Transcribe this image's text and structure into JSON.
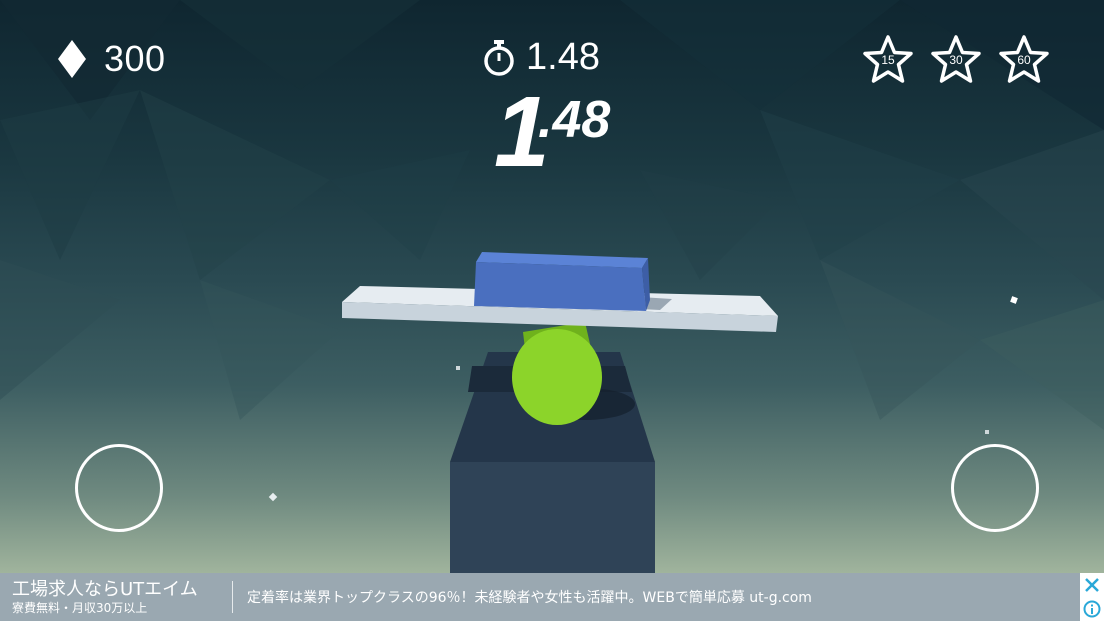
{
  "hud": {
    "gems": "300",
    "timer": "1.48",
    "big_time_int": "1",
    "big_time_frac": ".48",
    "stars": [
      {
        "label": "15"
      },
      {
        "label": "30"
      },
      {
        "label": "60"
      }
    ]
  },
  "icons": {
    "gem": "diamond-icon",
    "timer": "stopwatch-icon",
    "star": "star-outline-icon",
    "close": "close-icon",
    "info": "info-icon"
  },
  "colors": {
    "plank": "#dfe6ec",
    "block": "#4a6fbf",
    "roller": "#8cd42a",
    "pillar": "#2f4357",
    "ad_bar": "#9aa8b1",
    "ad_icon": "#2aa8d8"
  },
  "ad": {
    "title": "工場求人ならUTエイム",
    "subtitle": "寮費無料・月収30万以上",
    "description": "定着率は業界トップクラスの96％！未経験者や女性も活躍中。WEBで簡単応募 ut-g.com"
  }
}
